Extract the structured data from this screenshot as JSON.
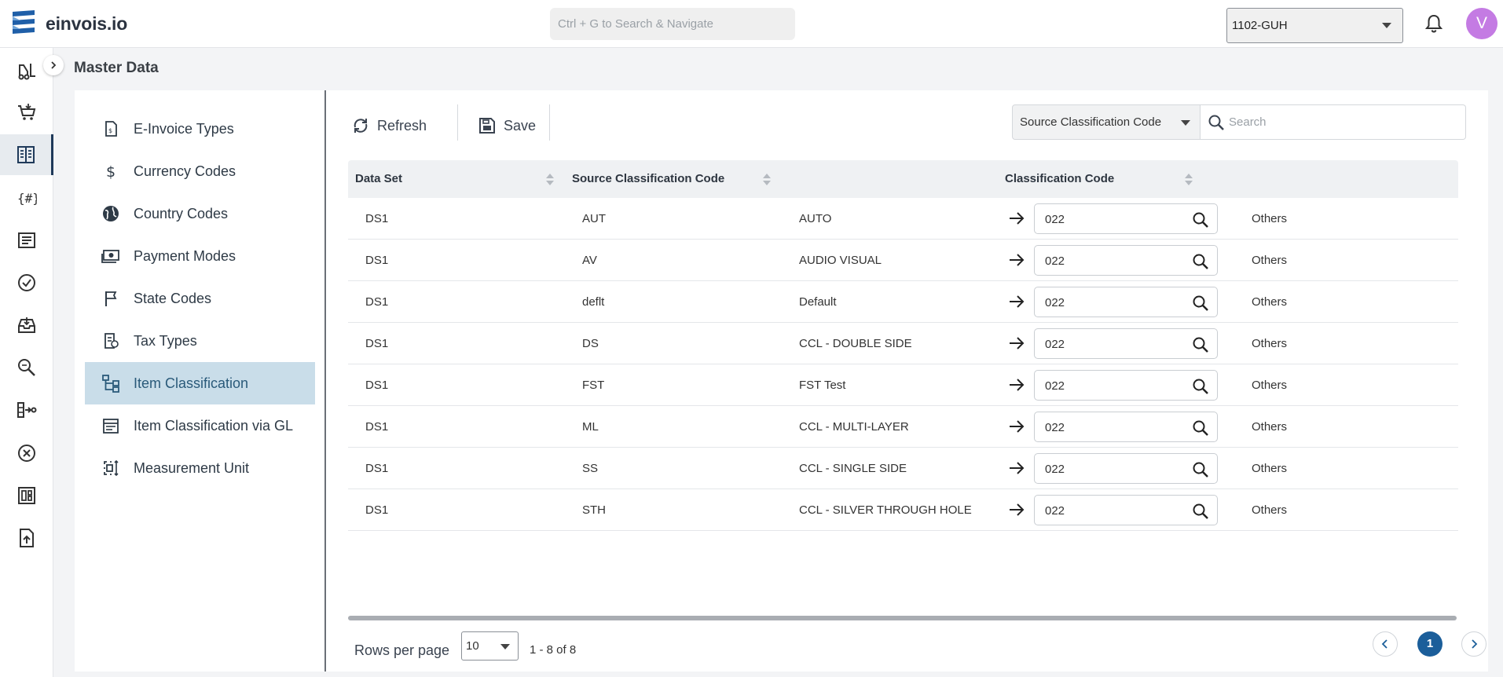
{
  "app": {
    "brand": "einvois.io",
    "search_placeholder": "Ctrl + G to Search & Navigate",
    "company": "1102-GUH",
    "avatar_initial": "V"
  },
  "rail": {
    "items": [
      "forklift-icon",
      "cart-icon",
      "master-data-icon",
      "code-braces-icon",
      "document-list-icon",
      "check-circle-icon",
      "inbox-icon",
      "search-doc-icon",
      "flow-icon",
      "cancel-circle-icon",
      "dashboard-icon",
      "upload-file-icon"
    ],
    "active_index": 2
  },
  "page": {
    "title": "Master Data"
  },
  "menu": {
    "items": [
      {
        "label": "E-Invoice Types",
        "icon": "invoice-icon"
      },
      {
        "label": "Currency Codes",
        "icon": "dollar-icon"
      },
      {
        "label": "Country Codes",
        "icon": "globe-icon"
      },
      {
        "label": "Payment Modes",
        "icon": "payment-icon"
      },
      {
        "label": "State Codes",
        "icon": "flag-icon"
      },
      {
        "label": "Tax Types",
        "icon": "tax-icon"
      },
      {
        "label": "Item Classification",
        "icon": "hierarchy-icon"
      },
      {
        "label": "Item Classification via GL",
        "icon": "list-box-icon"
      },
      {
        "label": "Measurement Unit",
        "icon": "measure-icon"
      }
    ],
    "active_index": 6
  },
  "toolbar": {
    "refresh_label": "Refresh",
    "save_label": "Save"
  },
  "filter": {
    "field": "Source Classification Code",
    "search_placeholder": "Search"
  },
  "table": {
    "headers": {
      "data_set": "Data Set",
      "source_code": "Source Classification Code",
      "class_code": "Classification Code"
    },
    "rows": [
      {
        "data_set": "DS1",
        "source_code": "AUT",
        "description": "AUTO",
        "code": "022",
        "class_desc": "Others"
      },
      {
        "data_set": "DS1",
        "source_code": "AV",
        "description": "AUDIO VISUAL",
        "code": "022",
        "class_desc": "Others"
      },
      {
        "data_set": "DS1",
        "source_code": "deflt",
        "description": "Default",
        "code": "022",
        "class_desc": "Others"
      },
      {
        "data_set": "DS1",
        "source_code": "DS",
        "description": "CCL - DOUBLE SIDE",
        "code": "022",
        "class_desc": "Others"
      },
      {
        "data_set": "DS1",
        "source_code": "FST",
        "description": "FST Test",
        "code": "022",
        "class_desc": "Others"
      },
      {
        "data_set": "DS1",
        "source_code": "ML",
        "description": "CCL - MULTI-LAYER",
        "code": "022",
        "class_desc": "Others"
      },
      {
        "data_set": "DS1",
        "source_code": "SS",
        "description": "CCL - SINGLE SIDE",
        "code": "022",
        "class_desc": "Others"
      },
      {
        "data_set": "DS1",
        "source_code": "STH",
        "description": "CCL - SILVER THROUGH HOLE",
        "code": "022",
        "class_desc": "Others"
      }
    ]
  },
  "pagination": {
    "rows_per_page_label": "Rows per page",
    "rows_per_page": "10",
    "range": "1 - 8 of 8",
    "current_page": "1"
  },
  "colors": {
    "accent": "#1b5e9a",
    "active_menu_bg": "#c9dde9",
    "avatar": "#c47be3"
  }
}
